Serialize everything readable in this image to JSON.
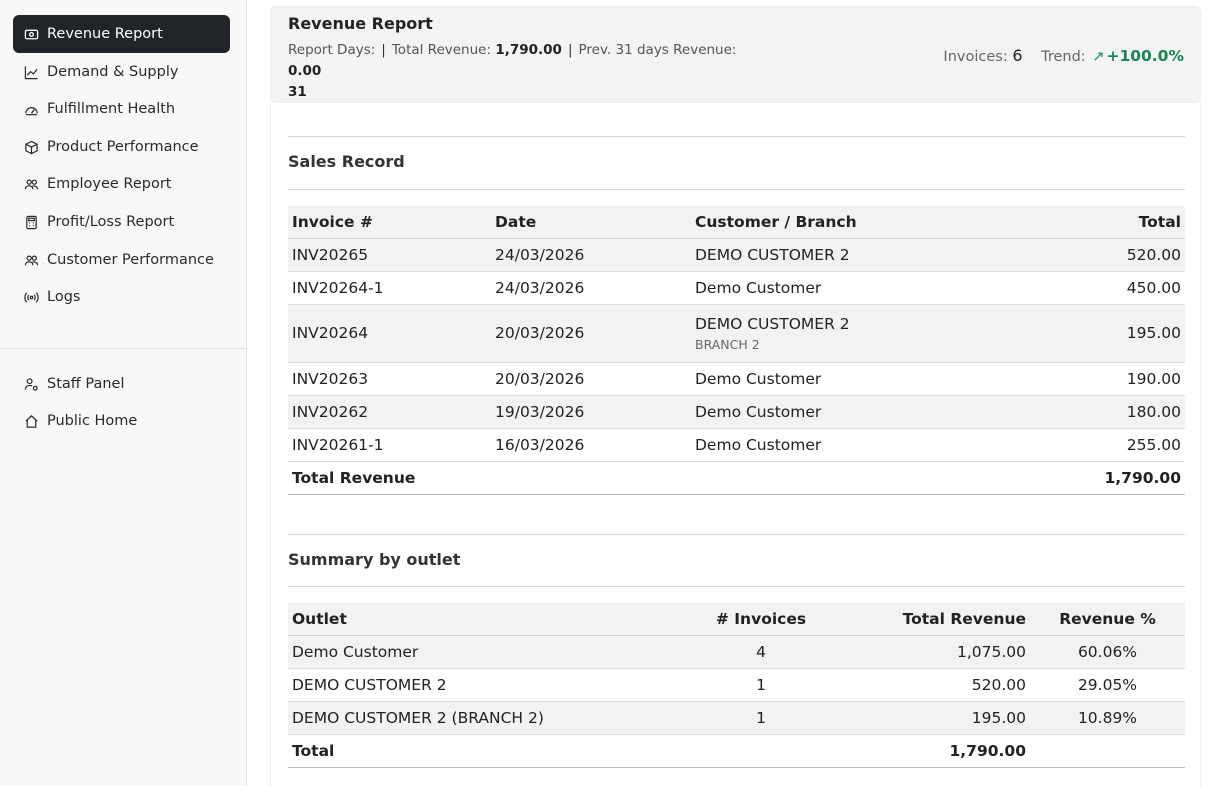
{
  "sidebar": {
    "items": [
      {
        "label": "Revenue Report",
        "icon": "cash-icon"
      },
      {
        "label": "Demand & Supply",
        "icon": "line-chart-icon"
      },
      {
        "label": "Fulfillment Health",
        "icon": "speedometer-icon"
      },
      {
        "label": "Product Performance",
        "icon": "box-icon"
      },
      {
        "label": "Employee Report",
        "icon": "people-icon"
      },
      {
        "label": "Profit/Loss Report",
        "icon": "calculator-icon"
      },
      {
        "label": "Customer Performance",
        "icon": "people-icon"
      },
      {
        "label": "Logs",
        "icon": "broadcast-icon"
      }
    ],
    "bottom_items": [
      {
        "label": "Staff Panel",
        "icon": "person-gear-icon"
      },
      {
        "label": "Public Home",
        "icon": "house-icon"
      }
    ]
  },
  "header": {
    "title": "Revenue Report",
    "report_days_label": "Report Days:",
    "report_days_value": "31",
    "total_revenue_label": "Total Revenue:",
    "total_revenue_value": "1,790.00",
    "prev_label": "Prev. 31 days Revenue:",
    "prev_value": "0.00",
    "invoices_label": "Invoices:",
    "invoices_value": "6",
    "trend_label": "Trend:",
    "trend_value": "+100.0%",
    "trend_color": "#198754"
  },
  "sales": {
    "title": "Sales Record",
    "columns": [
      "Invoice #",
      "Date",
      "Customer / Branch",
      "Total"
    ],
    "rows": [
      {
        "invoice": "INV20265",
        "date": "24/03/2026",
        "customer": "DEMO CUSTOMER 2",
        "branch": "",
        "total": "520.00"
      },
      {
        "invoice": "INV20264-1",
        "date": "24/03/2026",
        "customer": "Demo Customer",
        "branch": "",
        "total": "450.00"
      },
      {
        "invoice": "INV20264",
        "date": "20/03/2026",
        "customer": "DEMO CUSTOMER 2",
        "branch": "BRANCH 2",
        "total": "195.00"
      },
      {
        "invoice": "INV20263",
        "date": "20/03/2026",
        "customer": "Demo Customer",
        "branch": "",
        "total": "190.00"
      },
      {
        "invoice": "INV20262",
        "date": "19/03/2026",
        "customer": "Demo Customer",
        "branch": "",
        "total": "180.00"
      },
      {
        "invoice": "INV20261-1",
        "date": "16/03/2026",
        "customer": "Demo Customer",
        "branch": "",
        "total": "255.00"
      }
    ],
    "total_label": "Total Revenue",
    "total_value": "1,790.00"
  },
  "summary": {
    "title": "Summary by outlet",
    "columns": [
      "Outlet",
      "# Invoices",
      "Total Revenue",
      "Revenue %"
    ],
    "rows": [
      {
        "outlet": "Demo Customer",
        "invoices": "4",
        "revenue": "1,075.00",
        "percent": "60.06%"
      },
      {
        "outlet": "DEMO CUSTOMER 2",
        "invoices": "1",
        "revenue": "520.00",
        "percent": "29.05%"
      },
      {
        "outlet": "DEMO CUSTOMER 2 (BRANCH 2)",
        "invoices": "1",
        "revenue": "195.00",
        "percent": "10.89%"
      }
    ],
    "total_label": "Total",
    "total_value": "1,790.00"
  }
}
